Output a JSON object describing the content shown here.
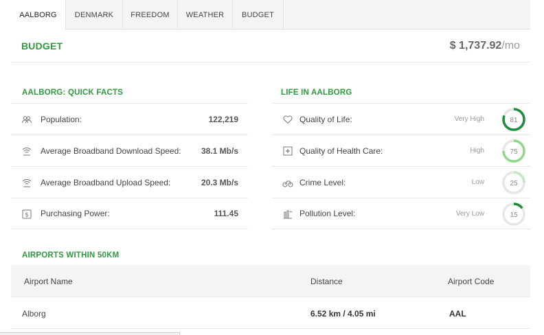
{
  "tabs": [
    {
      "label": "AALBORG",
      "active": true
    },
    {
      "label": "DENMARK",
      "active": false
    },
    {
      "label": "FREEDOM",
      "active": false
    },
    {
      "label": "WEATHER",
      "active": false
    },
    {
      "label": "BUDGET",
      "active": false
    }
  ],
  "budget": {
    "title": "BUDGET",
    "amount": "$ 1,737.92",
    "unit": "/mo"
  },
  "quick_facts": {
    "title": "AALBORG: QUICK FACTS",
    "items": [
      {
        "icon": "population-icon",
        "label": "Population:",
        "value": "122,219"
      },
      {
        "icon": "wifi-download-icon",
        "label": "Average Broadband Download Speed:",
        "value": "38.1 Mb/s"
      },
      {
        "icon": "wifi-upload-icon",
        "label": "Average Broadband Upload Speed:",
        "value": "20.3 Mb/s"
      },
      {
        "icon": "dollar-icon",
        "label": "Purchasing Power:",
        "value": "111.45"
      }
    ]
  },
  "life": {
    "title": "LIFE IN AALBORG",
    "items": [
      {
        "icon": "heart-icon",
        "label": "Quality of Life:",
        "rating": "Very High",
        "score": "81",
        "color": "#1e8a3a"
      },
      {
        "icon": "health-icon",
        "label": "Quality of Health Care:",
        "rating": "High",
        "score": "75",
        "color": "#8fd88f"
      },
      {
        "icon": "bicycle-icon",
        "label": "Crime Level:",
        "rating": "Low",
        "score": "25",
        "color": "#bfe8bf"
      },
      {
        "icon": "factory-icon",
        "label": "Pollution Level:",
        "rating": "Very Low",
        "score": "15",
        "color": "#1e8a3a"
      }
    ]
  },
  "airports": {
    "title": "AIRPORTS WITHIN 50KM",
    "columns": [
      "Airport Name",
      "Distance",
      "Airport Code"
    ],
    "rows": [
      {
        "name": "Alborg",
        "distance": "6.52 km / 4.05 mi",
        "code": "AAL"
      }
    ]
  }
}
